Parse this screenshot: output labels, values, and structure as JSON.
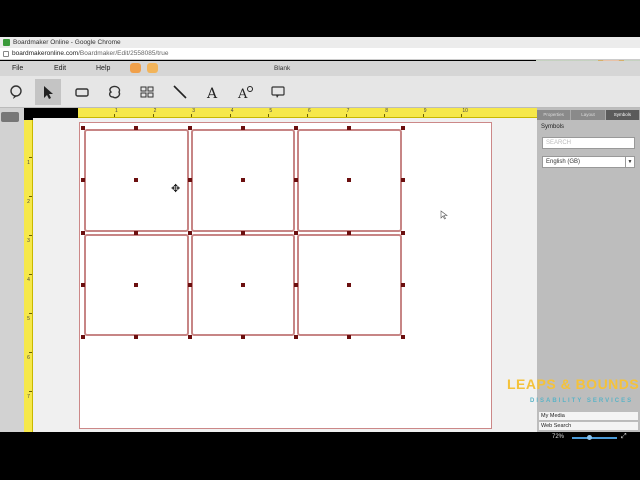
{
  "browser": {
    "window_title": "Boardmaker Online - Google Chrome",
    "url_domain": "boardmakeronline.com",
    "url_path": "/Boardmaker/Edit/2558085/true"
  },
  "menu": {
    "file": "File",
    "edit": "Edit",
    "help": "Help",
    "document_title": "Blank"
  },
  "toolbar": {
    "tools": [
      "speech-bubble-icon",
      "pointer-icon",
      "rectangle-icon",
      "freeform-shape-icon",
      "grid-icon",
      "line-icon",
      "text-icon",
      "text-style-icon",
      "comment-icon"
    ],
    "active_tool": "pointer-icon"
  },
  "rulers": {
    "horizontal_labels": [
      "1",
      "2",
      "3",
      "4",
      "5",
      "6",
      "7",
      "8",
      "9",
      "10"
    ],
    "vertical_labels": [
      "1",
      "2",
      "3",
      "4",
      "5",
      "6",
      "7"
    ]
  },
  "grid": {
    "rows": 2,
    "columns": 3
  },
  "right_panel": {
    "tabs": [
      "Properties",
      "Layout",
      "Symbols"
    ],
    "active_tab": "Symbols",
    "section_label": "Symbols",
    "search_placeholder": "SEARCH",
    "language": "English (GB)",
    "links": [
      "My Media",
      "Web Search"
    ]
  },
  "status": {
    "zoom": "72%"
  },
  "watermark": {
    "name": "LEAPS & BOUNDS",
    "tagline": "DISABILITY SERVICES"
  },
  "colors": {
    "ruler": "#f6e84a",
    "cell_border": "#c78585",
    "handle": "#6b0f0f",
    "logo": "#f4c23a",
    "tagline": "#5bb3c6"
  }
}
